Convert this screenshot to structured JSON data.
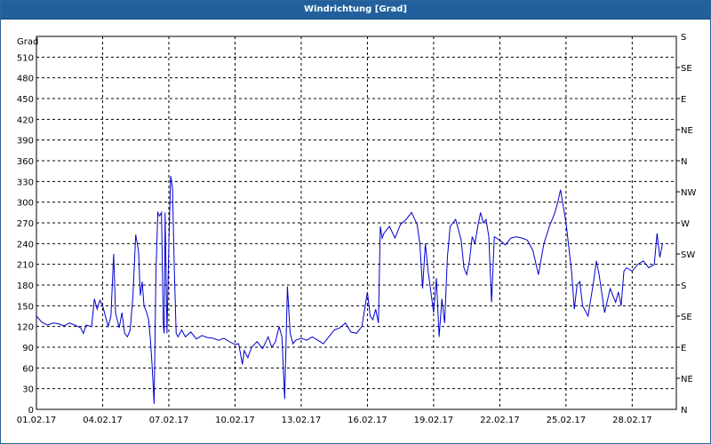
{
  "window": {
    "title": "Windrichtung [Grad]"
  },
  "colors": {
    "title_bar": "#21609d",
    "series_line": "#0000cc",
    "grid": "#000000",
    "background": "#ffffff"
  },
  "chart_data": {
    "type": "line",
    "title": "Windrichtung [Grad]",
    "ylabel": "Grad",
    "xlabel": "",
    "ylim": [
      0,
      540
    ],
    "yticks": [
      0,
      30,
      60,
      90,
      120,
      150,
      180,
      210,
      240,
      270,
      300,
      330,
      360,
      390,
      420,
      450,
      480,
      510
    ],
    "xlim": [
      "2017-02-01",
      "2017-03-02"
    ],
    "xticks": [
      "01.02.17",
      "04.02.17",
      "07.02.17",
      "10.02.17",
      "13.02.17",
      "16.02.17",
      "19.02.17",
      "22.02.17",
      "25.02.17",
      "28.02.17"
    ],
    "right_axis_labels": [
      "N",
      "NE",
      "E",
      "SE",
      "S",
      "SW",
      "W",
      "NW",
      "N",
      "NE",
      "E",
      "SE",
      "S"
    ],
    "grid": true,
    "grid_style": "dashed",
    "series": [
      {
        "color": "#0000cc",
        "points": [
          [
            "2017-02-01T00:00",
            135
          ],
          [
            "2017-02-01T06:00",
            126
          ],
          [
            "2017-02-01T12:00",
            122
          ],
          [
            "2017-02-01T18:00",
            125
          ],
          [
            "2017-02-02T00:00",
            124
          ],
          [
            "2017-02-02T06:00",
            121
          ],
          [
            "2017-02-02T12:00",
            125
          ],
          [
            "2017-02-02T18:00",
            122
          ],
          [
            "2017-02-03T00:00",
            118
          ],
          [
            "2017-02-03T03:00",
            110
          ],
          [
            "2017-02-03T06:00",
            122
          ],
          [
            "2017-02-03T12:00",
            120
          ],
          [
            "2017-02-03T15:00",
            160
          ],
          [
            "2017-02-03T18:00",
            145
          ],
          [
            "2017-02-03T21:00",
            158
          ],
          [
            "2017-02-04T00:00",
            150
          ],
          [
            "2017-02-04T03:00",
            135
          ],
          [
            "2017-02-04T06:00",
            120
          ],
          [
            "2017-02-04T09:00",
            135
          ],
          [
            "2017-02-04T12:00",
            225
          ],
          [
            "2017-02-04T14:00",
            140
          ],
          [
            "2017-02-04T18:00",
            118
          ],
          [
            "2017-02-04T21:00",
            140
          ],
          [
            "2017-02-05T00:00",
            110
          ],
          [
            "2017-02-05T03:00",
            105
          ],
          [
            "2017-02-05T06:00",
            115
          ],
          [
            "2017-02-05T09:00",
            165
          ],
          [
            "2017-02-05T12:00",
            253
          ],
          [
            "2017-02-05T15:00",
            230
          ],
          [
            "2017-02-05T17:00",
            165
          ],
          [
            "2017-02-05T19:00",
            185
          ],
          [
            "2017-02-05T21:00",
            150
          ],
          [
            "2017-02-06T00:00",
            140
          ],
          [
            "2017-02-06T02:00",
            130
          ],
          [
            "2017-02-06T04:00",
            100
          ],
          [
            "2017-02-06T06:00",
            60
          ],
          [
            "2017-02-06T08:00",
            8
          ],
          [
            "2017-02-06T10:00",
            200
          ],
          [
            "2017-02-06T12:00",
            285
          ],
          [
            "2017-02-06T14:00",
            280
          ],
          [
            "2017-02-06T16:00",
            285
          ],
          [
            "2017-02-06T18:00",
            120
          ],
          [
            "2017-02-06T19:00",
            110
          ],
          [
            "2017-02-06T20:00",
            285
          ],
          [
            "2017-02-06T22:00",
            110
          ],
          [
            "2017-02-07T00:00",
            240
          ],
          [
            "2017-02-07T02:00",
            338
          ],
          [
            "2017-02-07T04:00",
            320
          ],
          [
            "2017-02-07T06:00",
            200
          ],
          [
            "2017-02-07T08:00",
            110
          ],
          [
            "2017-02-07T10:00",
            105
          ],
          [
            "2017-02-07T14:00",
            115
          ],
          [
            "2017-02-07T18:00",
            105
          ],
          [
            "2017-02-08T00:00",
            112
          ],
          [
            "2017-02-08T06:00",
            102
          ],
          [
            "2017-02-08T12:00",
            107
          ],
          [
            "2017-02-08T18:00",
            104
          ],
          [
            "2017-02-09T00:00",
            103
          ],
          [
            "2017-02-09T06:00",
            100
          ],
          [
            "2017-02-09T12:00",
            103
          ],
          [
            "2017-02-09T18:00",
            98
          ],
          [
            "2017-02-10T00:00",
            94
          ],
          [
            "2017-02-10T04:00",
            95
          ],
          [
            "2017-02-10T06:00",
            80
          ],
          [
            "2017-02-10T08:00",
            65
          ],
          [
            "2017-02-10T10:00",
            85
          ],
          [
            "2017-02-10T14:00",
            75
          ],
          [
            "2017-02-10T18:00",
            90
          ],
          [
            "2017-02-11T00:00",
            98
          ],
          [
            "2017-02-11T06:00",
            88
          ],
          [
            "2017-02-11T12:00",
            105
          ],
          [
            "2017-02-11T16:00",
            90
          ],
          [
            "2017-02-11T20:00",
            98
          ],
          [
            "2017-02-12T00:00",
            120
          ],
          [
            "2017-02-12T03:00",
            105
          ],
          [
            "2017-02-12T06:00",
            15
          ],
          [
            "2017-02-12T09:00",
            178
          ],
          [
            "2017-02-12T12:00",
            110
          ],
          [
            "2017-02-12T15:00",
            95
          ],
          [
            "2017-02-12T18:00",
            100
          ],
          [
            "2017-02-13T00:00",
            103
          ],
          [
            "2017-02-13T06:00",
            100
          ],
          [
            "2017-02-13T12:00",
            105
          ],
          [
            "2017-02-13T18:00",
            100
          ],
          [
            "2017-02-14T00:00",
            95
          ],
          [
            "2017-02-14T06:00",
            105
          ],
          [
            "2017-02-14T12:00",
            115
          ],
          [
            "2017-02-14T18:00",
            118
          ],
          [
            "2017-02-15T00:00",
            125
          ],
          [
            "2017-02-15T06:00",
            112
          ],
          [
            "2017-02-15T12:00",
            110
          ],
          [
            "2017-02-15T18:00",
            120
          ],
          [
            "2017-02-16T00:00",
            170
          ],
          [
            "2017-02-16T03:00",
            135
          ],
          [
            "2017-02-16T06:00",
            130
          ],
          [
            "2017-02-16T09:00",
            145
          ],
          [
            "2017-02-16T12:00",
            125
          ],
          [
            "2017-02-16T14:00",
            265
          ],
          [
            "2017-02-16T16:00",
            248
          ],
          [
            "2017-02-16T18:00",
            255
          ],
          [
            "2017-02-17T00:00",
            265
          ],
          [
            "2017-02-17T06:00",
            248
          ],
          [
            "2017-02-17T12:00",
            268
          ],
          [
            "2017-02-17T18:00",
            275
          ],
          [
            "2017-02-18T00:00",
            285
          ],
          [
            "2017-02-18T06:00",
            268
          ],
          [
            "2017-02-18T09:00",
            240
          ],
          [
            "2017-02-18T12:00",
            175
          ],
          [
            "2017-02-18T15:00",
            240
          ],
          [
            "2017-02-18T18:00",
            200
          ],
          [
            "2017-02-19T00:00",
            140
          ],
          [
            "2017-02-19T03:00",
            190
          ],
          [
            "2017-02-19T06:00",
            105
          ],
          [
            "2017-02-19T09:00",
            160
          ],
          [
            "2017-02-19T12:00",
            125
          ],
          [
            "2017-02-19T15:00",
            220
          ],
          [
            "2017-02-19T18:00",
            265
          ],
          [
            "2017-02-20T00:00",
            275
          ],
          [
            "2017-02-20T03:00",
            260
          ],
          [
            "2017-02-20T06:00",
            245
          ],
          [
            "2017-02-20T09:00",
            205
          ],
          [
            "2017-02-20T12:00",
            195
          ],
          [
            "2017-02-20T15:00",
            215
          ],
          [
            "2017-02-20T18:00",
            250
          ],
          [
            "2017-02-20T21:00",
            240
          ],
          [
            "2017-02-21T00:00",
            265
          ],
          [
            "2017-02-21T03:00",
            285
          ],
          [
            "2017-02-21T06:00",
            270
          ],
          [
            "2017-02-21T09:00",
            275
          ],
          [
            "2017-02-21T12:00",
            250
          ],
          [
            "2017-02-21T15:00",
            155
          ],
          [
            "2017-02-21T18:00",
            250
          ],
          [
            "2017-02-22T00:00",
            245
          ],
          [
            "2017-02-22T06:00",
            238
          ],
          [
            "2017-02-22T12:00",
            248
          ],
          [
            "2017-02-22T18:00",
            250
          ],
          [
            "2017-02-23T00:00",
            248
          ],
          [
            "2017-02-23T06:00",
            245
          ],
          [
            "2017-02-23T12:00",
            230
          ],
          [
            "2017-02-23T18:00",
            195
          ],
          [
            "2017-02-24T00:00",
            240
          ],
          [
            "2017-02-24T06:00",
            265
          ],
          [
            "2017-02-24T12:00",
            285
          ],
          [
            "2017-02-24T15:00",
            300
          ],
          [
            "2017-02-24T18:00",
            318
          ],
          [
            "2017-02-25T00:00",
            270
          ],
          [
            "2017-02-25T06:00",
            200
          ],
          [
            "2017-02-25T09:00",
            145
          ],
          [
            "2017-02-25T12:00",
            180
          ],
          [
            "2017-02-25T15:00",
            185
          ],
          [
            "2017-02-25T18:00",
            150
          ],
          [
            "2017-02-26T00:00",
            135
          ],
          [
            "2017-02-26T06:00",
            185
          ],
          [
            "2017-02-26T09:00",
            215
          ],
          [
            "2017-02-26T12:00",
            195
          ],
          [
            "2017-02-26T18:00",
            140
          ],
          [
            "2017-02-27T00:00",
            175
          ],
          [
            "2017-02-27T06:00",
            155
          ],
          [
            "2017-02-27T09:00",
            170
          ],
          [
            "2017-02-27T12:00",
            150
          ],
          [
            "2017-02-27T15:00",
            200
          ],
          [
            "2017-02-27T18:00",
            205
          ],
          [
            "2017-02-28T00:00",
            200
          ],
          [
            "2017-02-28T06:00",
            210
          ],
          [
            "2017-02-28T12:00",
            215
          ],
          [
            "2017-02-28T18:00",
            205
          ],
          [
            "2017-03-01T00:00",
            210
          ],
          [
            "2017-03-01T03:00",
            255
          ],
          [
            "2017-03-01T06:00",
            220
          ],
          [
            "2017-03-01T09:00",
            240
          ]
        ]
      }
    ]
  }
}
